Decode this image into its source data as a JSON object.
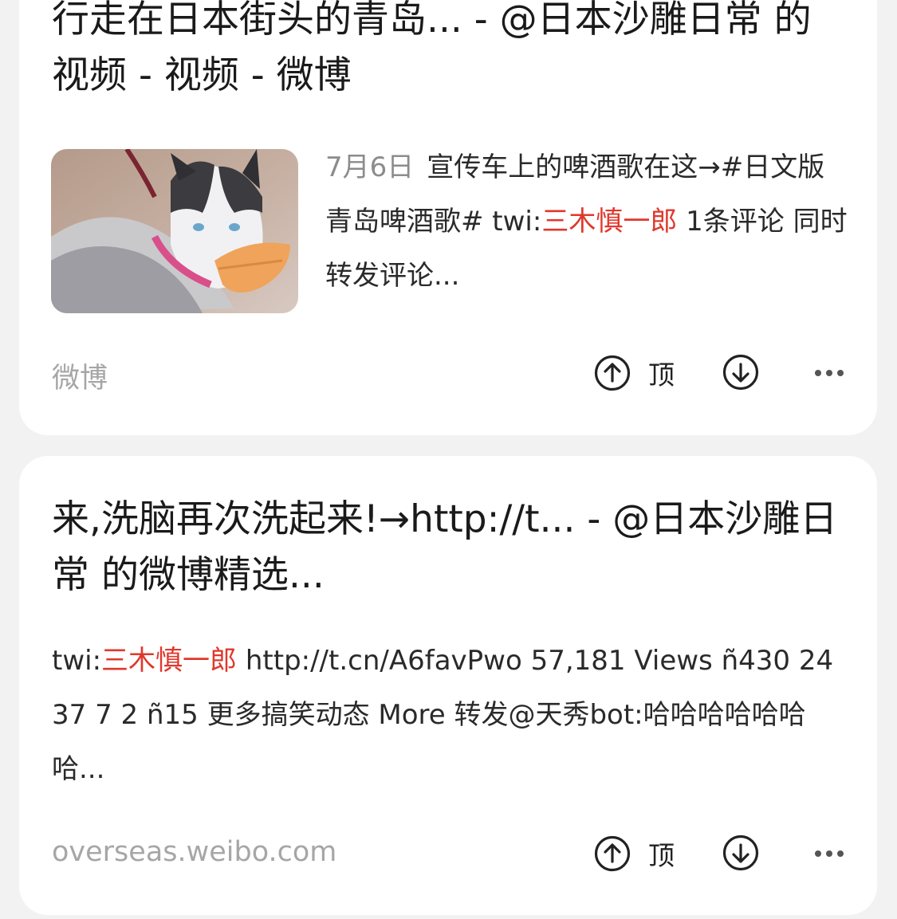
{
  "colors": {
    "background": "#f2f2f2",
    "card": "#ffffff",
    "highlight": "#e0382c",
    "muted": "#a6a6a6"
  },
  "results": [
    {
      "title": "行走在日本街头的青岛... - @日本沙雕日常 的视频 - 视频 - 微博",
      "has_thumbnail": true,
      "thumbnail_icon": "husky-with-duck-beak-thumbnail",
      "date": "7月6日",
      "snippet_before": "宣传车上的啤酒歌在这→#日文版青岛啤酒歌# twi:",
      "snippet_highlight": "三木慎一郎",
      "snippet_after": " 1条评论 同时转发评论...",
      "source": "微博",
      "upvote_label": "顶",
      "upvote_icon": "up-arrow-circle-icon",
      "downvote_icon": "down-arrow-circle-icon",
      "more_icon": "more-dots-icon"
    },
    {
      "title": "来,洗脑再次洗起来!→http://t... - @日本沙雕日常 的微博精选...",
      "has_thumbnail": false,
      "snippet_before": "twi:",
      "snippet_highlight": "三木慎一郎",
      "snippet_after": " http://t.cn/A6favPwo  57,181 Views ñ430 24 37 7 2 ñ15 更多搞笑动态 More 转发@天秀bot:哈哈哈哈哈哈哈...",
      "source": "overseas.weibo.com",
      "upvote_label": "顶",
      "upvote_icon": "up-arrow-circle-icon",
      "downvote_icon": "down-arrow-circle-icon",
      "more_icon": "more-dots-icon"
    }
  ]
}
